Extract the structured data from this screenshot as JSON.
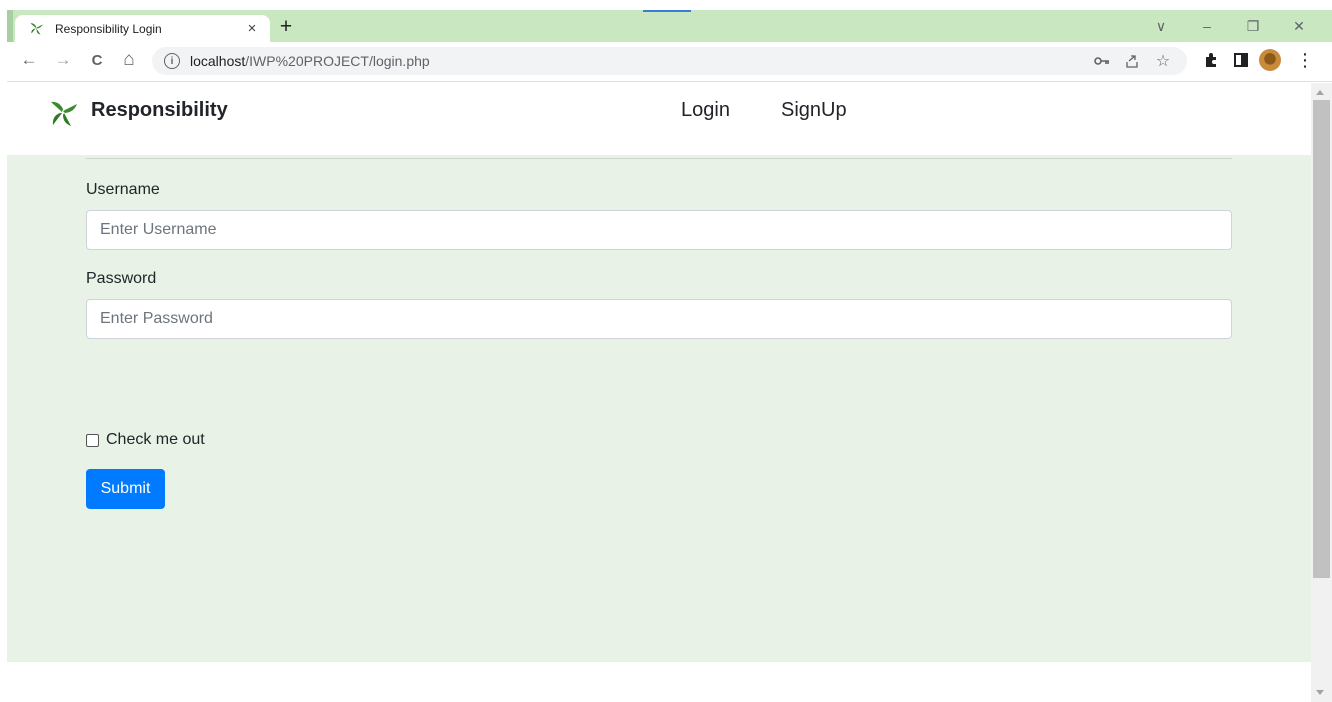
{
  "browser": {
    "tab": {
      "title": "Responsibility Login",
      "close": "×"
    },
    "new_tab": "+",
    "window_controls": {
      "chevron": "∨",
      "minimize": "–",
      "restore": "❐",
      "close": "✕"
    },
    "nav": {
      "back": "←",
      "forward": "→",
      "reload": "C",
      "home": "⌂"
    },
    "address": {
      "host": "localhost",
      "path": "/IWP%20PROJECT/login.php"
    },
    "icons": [
      "key-icon",
      "share-icon",
      "star-icon",
      "extensions-icon",
      "sidepanel-icon",
      "profile-avatar",
      "menu-icon"
    ],
    "menu_glyph": "⋮"
  },
  "site": {
    "brand": "Responsibility",
    "brand_color": "#3a8a2e",
    "nav": {
      "login": "Login",
      "signup": "SignUp"
    }
  },
  "form": {
    "username_label": "Username",
    "username_placeholder": "Enter Username",
    "password_label": "Password",
    "password_placeholder": "Enter Password",
    "check_label": "Check me out",
    "submit_label": "Submit"
  },
  "colors": {
    "tabstrip": "#c9e7c0",
    "content_bg": "#e9f2e6",
    "primary": "#007bff"
  }
}
